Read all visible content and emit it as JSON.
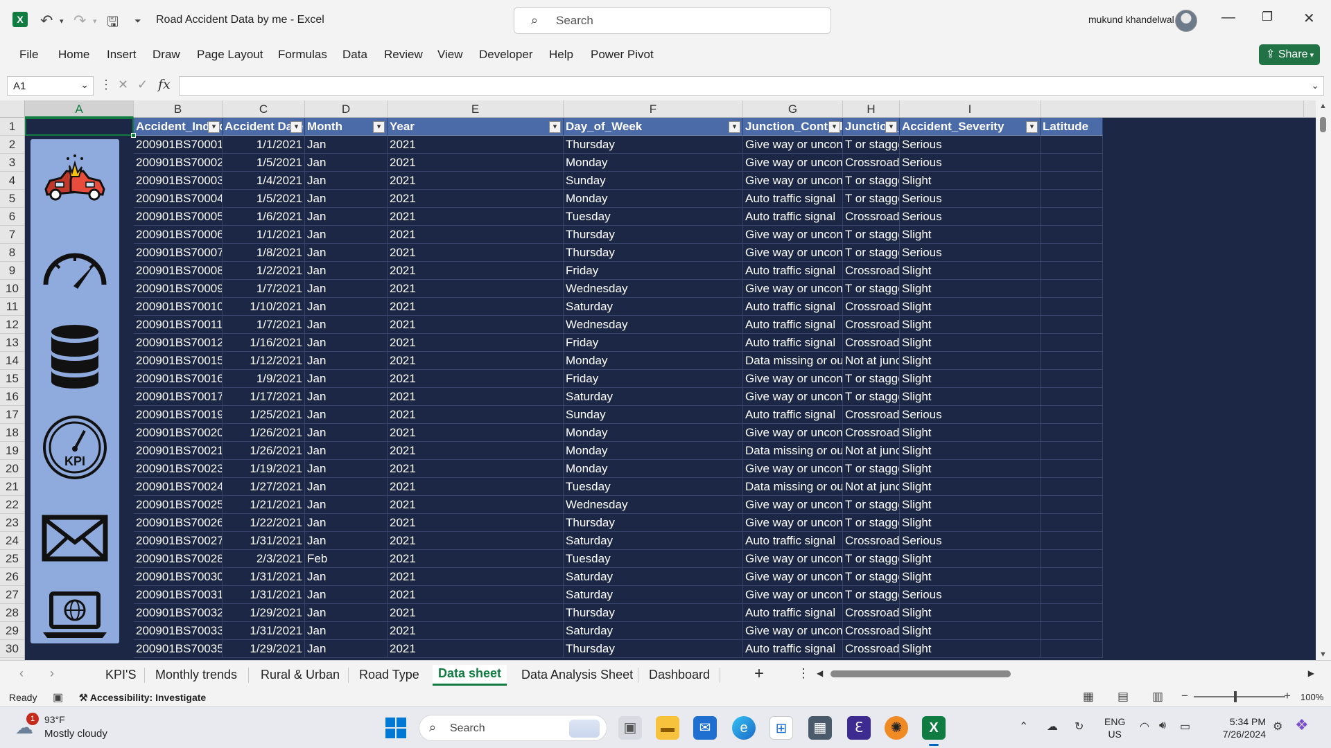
{
  "titlebar": {
    "document_title": "Road Accident Data by me  -  Excel",
    "search_placeholder": "Search",
    "user_name": "mukund khandelwal"
  },
  "menu": [
    "File",
    "Home",
    "Insert",
    "Draw",
    "Page Layout",
    "Formulas",
    "Data",
    "Review",
    "View",
    "Developer",
    "Help",
    "Power Pivot"
  ],
  "share_label": "Share",
  "formula_bar": {
    "name_box": "A1",
    "fx": "fx",
    "formula": ""
  },
  "columns": [
    "A",
    "B",
    "C",
    "D",
    "E",
    "F",
    "G",
    "H",
    "I"
  ],
  "row_numbers": [
    "1",
    "2",
    "3",
    "4",
    "5",
    "6",
    "7",
    "8",
    "9",
    "10",
    "11",
    "12",
    "13",
    "14",
    "15",
    "16",
    "17",
    "18",
    "19",
    "20",
    "21",
    "22",
    "23",
    "24",
    "25",
    "26",
    "27",
    "28",
    "29",
    "30"
  ],
  "table_headers": [
    "Accident_Index",
    "Accident Date",
    "Month",
    "Year",
    "Day_of_Week",
    "Junction_Control",
    "Junction_",
    "Accident_Severity",
    "Latitude"
  ],
  "rows": [
    [
      "200901BS70001",
      "1/1/2021",
      "Jan",
      "2021",
      "Thursday",
      "Give way or uncontrolled",
      "T or staggered",
      "Serious"
    ],
    [
      "200901BS70002",
      "1/5/2021",
      "Jan",
      "2021",
      "Monday",
      "Give way or uncontrolled",
      "Crossroads",
      "Serious"
    ],
    [
      "200901BS70003",
      "1/4/2021",
      "Jan",
      "2021",
      "Sunday",
      "Give way or uncontrolled",
      "T or staggered",
      "Slight"
    ],
    [
      "200901BS70004",
      "1/5/2021",
      "Jan",
      "2021",
      "Monday",
      "Auto traffic signal",
      "T or staggered",
      "Serious"
    ],
    [
      "200901BS70005",
      "1/6/2021",
      "Jan",
      "2021",
      "Tuesday",
      "Auto traffic signal",
      "Crossroads",
      "Serious"
    ],
    [
      "200901BS70006",
      "1/1/2021",
      "Jan",
      "2021",
      "Thursday",
      "Give way or uncontrolled",
      "T or staggered",
      "Slight"
    ],
    [
      "200901BS70007",
      "1/8/2021",
      "Jan",
      "2021",
      "Thursday",
      "Give way or uncontrolled",
      "T or staggered",
      "Serious"
    ],
    [
      "200901BS70008",
      "1/2/2021",
      "Jan",
      "2021",
      "Friday",
      "Auto traffic signal",
      "Crossroads",
      "Slight"
    ],
    [
      "200901BS70009",
      "1/7/2021",
      "Jan",
      "2021",
      "Wednesday",
      "Give way or uncontrolled",
      "T or staggered",
      "Slight"
    ],
    [
      "200901BS70010",
      "1/10/2021",
      "Jan",
      "2021",
      "Saturday",
      "Auto traffic signal",
      "Crossroads",
      "Slight"
    ],
    [
      "200901BS70011",
      "1/7/2021",
      "Jan",
      "2021",
      "Wednesday",
      "Auto traffic signal",
      "Crossroads",
      "Slight"
    ],
    [
      "200901BS70012",
      "1/16/2021",
      "Jan",
      "2021",
      "Friday",
      "Auto traffic signal",
      "Crossroads",
      "Slight"
    ],
    [
      "200901BS70015",
      "1/12/2021",
      "Jan",
      "2021",
      "Monday",
      "Data missing or out of range",
      "Not at junction",
      "Slight"
    ],
    [
      "200901BS70016",
      "1/9/2021",
      "Jan",
      "2021",
      "Friday",
      "Give way or uncontrolled",
      "T or staggered",
      "Slight"
    ],
    [
      "200901BS70017",
      "1/17/2021",
      "Jan",
      "2021",
      "Saturday",
      "Give way or uncontrolled",
      "T or staggered",
      "Slight"
    ],
    [
      "200901BS70019",
      "1/25/2021",
      "Jan",
      "2021",
      "Sunday",
      "Auto traffic signal",
      "Crossroads",
      "Serious"
    ],
    [
      "200901BS70020",
      "1/26/2021",
      "Jan",
      "2021",
      "Monday",
      "Give way or uncontrolled",
      "Crossroads",
      "Slight"
    ],
    [
      "200901BS70021",
      "1/26/2021",
      "Jan",
      "2021",
      "Monday",
      "Data missing or out of range",
      "Not at junction",
      "Slight"
    ],
    [
      "200901BS70023",
      "1/19/2021",
      "Jan",
      "2021",
      "Monday",
      "Give way or uncontrolled",
      "T or staggered",
      "Slight"
    ],
    [
      "200901BS70024",
      "1/27/2021",
      "Jan",
      "2021",
      "Tuesday",
      "Data missing or out of range",
      "Not at junction",
      "Slight"
    ],
    [
      "200901BS70025",
      "1/21/2021",
      "Jan",
      "2021",
      "Wednesday",
      "Give way or uncontrolled",
      "T or staggered",
      "Slight"
    ],
    [
      "200901BS70026",
      "1/22/2021",
      "Jan",
      "2021",
      "Thursday",
      "Give way or uncontrolled",
      "T or staggered",
      "Slight"
    ],
    [
      "200901BS70027",
      "1/31/2021",
      "Jan",
      "2021",
      "Saturday",
      "Auto traffic signal",
      "Crossroads",
      "Serious"
    ],
    [
      "200901BS70028",
      "2/3/2021",
      "Feb",
      "2021",
      "Tuesday",
      "Give way or uncontrolled",
      "T or staggered",
      "Slight"
    ],
    [
      "200901BS70030",
      "1/31/2021",
      "Jan",
      "2021",
      "Saturday",
      "Give way or uncontrolled",
      "T or staggered",
      "Slight"
    ],
    [
      "200901BS70031",
      "1/31/2021",
      "Jan",
      "2021",
      "Saturday",
      "Give way or uncontrolled",
      "T or staggered",
      "Serious"
    ],
    [
      "200901BS70032",
      "1/29/2021",
      "Jan",
      "2021",
      "Thursday",
      "Auto traffic signal",
      "Crossroads",
      "Slight"
    ],
    [
      "200901BS70033",
      "1/31/2021",
      "Jan",
      "2021",
      "Saturday",
      "Give way or uncontrolled",
      "Crossroads",
      "Slight"
    ],
    [
      "200901BS70035",
      "1/29/2021",
      "Jan",
      "2021",
      "Thursday",
      "Auto traffic signal",
      "Crossroads",
      "Slight"
    ]
  ],
  "side_panel_icons": [
    "car-crash-icon",
    "speedometer-icon",
    "database-icon",
    "kpi-gauge-icon",
    "mail-icon",
    "laptop-globe-icon"
  ],
  "kpi_icon_label": "KPI",
  "sheet_tabs": [
    "KPI'S",
    "Monthly trends",
    "Rural & Urban",
    "Road Type",
    "Data sheet",
    "Data Analysis Sheet",
    "Dashboard"
  ],
  "active_tab": "Data sheet",
  "status": {
    "ready": "Ready",
    "accessibility": "Accessibility: Investigate",
    "zoom": "100%"
  },
  "taskbar": {
    "weather_badge": "1",
    "weather_temp": "93°F",
    "weather_desc": "Mostly cloudy",
    "search_placeholder": "Search",
    "lang_line1": "ENG",
    "lang_line2": "US",
    "time": "5:34 PM",
    "date": "7/26/2024"
  },
  "colors": {
    "header_fill": "#4a6aa8",
    "sheet_background": "#1b2745",
    "side_panel": "#8faadc",
    "excel_green": "#107c41"
  }
}
